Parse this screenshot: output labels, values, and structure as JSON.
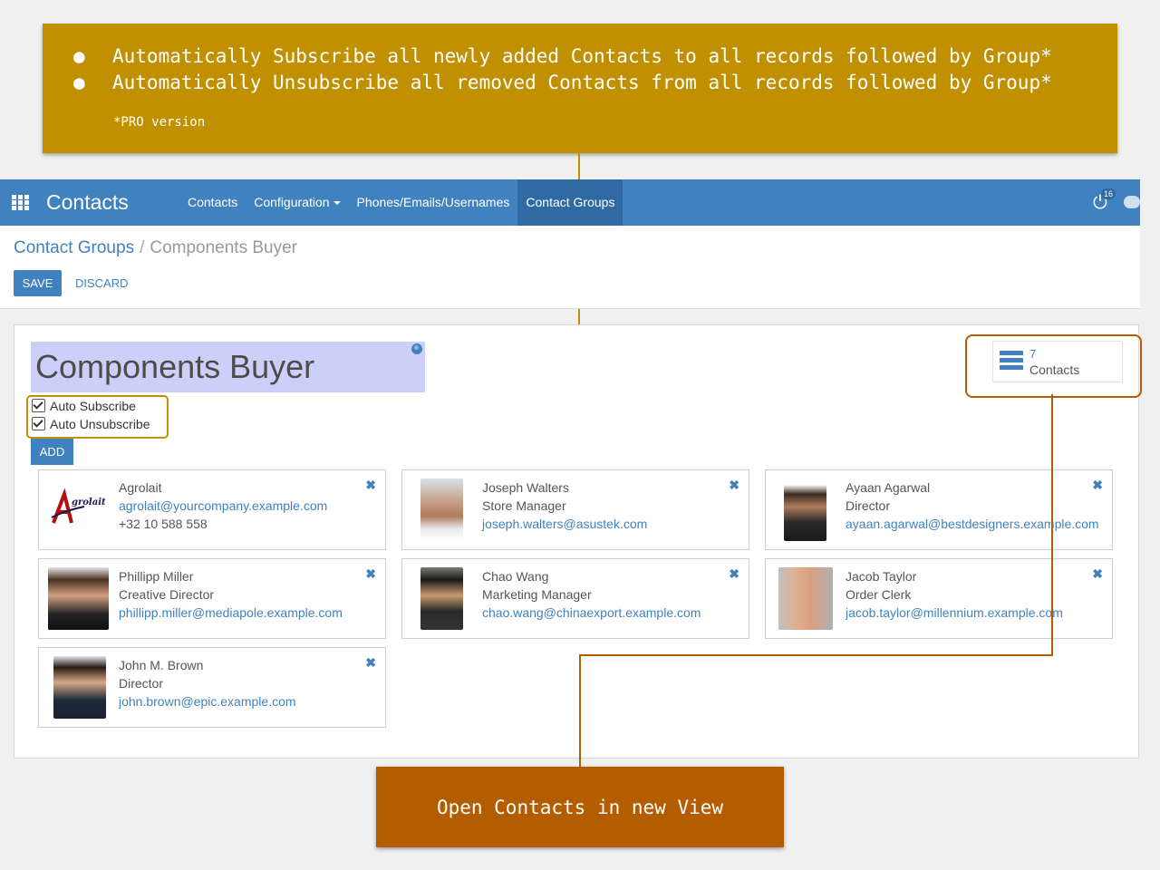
{
  "callout_top": {
    "items": [
      "Automatically Subscribe all newly added Contacts to all records followed by Group*",
      "Automatically Unsubscribe all removed Contacts from all records followed by Group*"
    ],
    "bullet": "●",
    "note": "*PRO version",
    "color": "#c09000"
  },
  "callout_bottom": {
    "text": "Open Contacts in new View",
    "color": "#b35c00"
  },
  "navbar": {
    "brand": "Contacts",
    "menu": [
      {
        "label": "Contacts"
      },
      {
        "label": "Configuration",
        "dropdown": true
      },
      {
        "label": "Phones/Emails/Usernames"
      },
      {
        "label": "Contact Groups",
        "active": true
      }
    ],
    "activity_badge": "16",
    "accent": "#3f82bf"
  },
  "breadcrumb": {
    "parent": "Contact Groups",
    "separator": "/",
    "current": "Components Buyer"
  },
  "buttons": {
    "save": "SAVE",
    "discard": "DISCARD",
    "add": "ADD"
  },
  "form": {
    "name": "Components Buyer",
    "auto_subscribe": {
      "label": "Auto Subscribe",
      "checked": true
    },
    "auto_unsubscribe": {
      "label": "Auto Unsubscribe",
      "checked": true
    }
  },
  "stat_button": {
    "count": "7",
    "label": "Contacts"
  },
  "contacts": [
    {
      "name": "Agrolait",
      "line2": "agrolait@yourcompany.example.com",
      "line3": "+32 10 588 558",
      "logo_text": "grolait"
    },
    {
      "name": "Joseph Walters",
      "line2": "Store Manager",
      "line3": "joseph.walters@asustek.com"
    },
    {
      "name": "Ayaan Agarwal",
      "line2": "Director",
      "line3": "ayaan.agarwal@bestdesigners.example.com"
    },
    {
      "name": "Phillipp Miller",
      "line2": "Creative Director",
      "line3": "phillipp.miller@mediapole.example.com"
    },
    {
      "name": "Chao Wang",
      "line2": "Marketing Manager",
      "line3": "chao.wang@chinaexport.example.com"
    },
    {
      "name": "Jacob Taylor",
      "line2": "Order Clerk",
      "line3": "jacob.taylor@millennium.example.com"
    },
    {
      "name": "John M. Brown",
      "line2": "Director",
      "line3": "john.brown@epic.example.com"
    }
  ],
  "remove_glyph": "✖"
}
